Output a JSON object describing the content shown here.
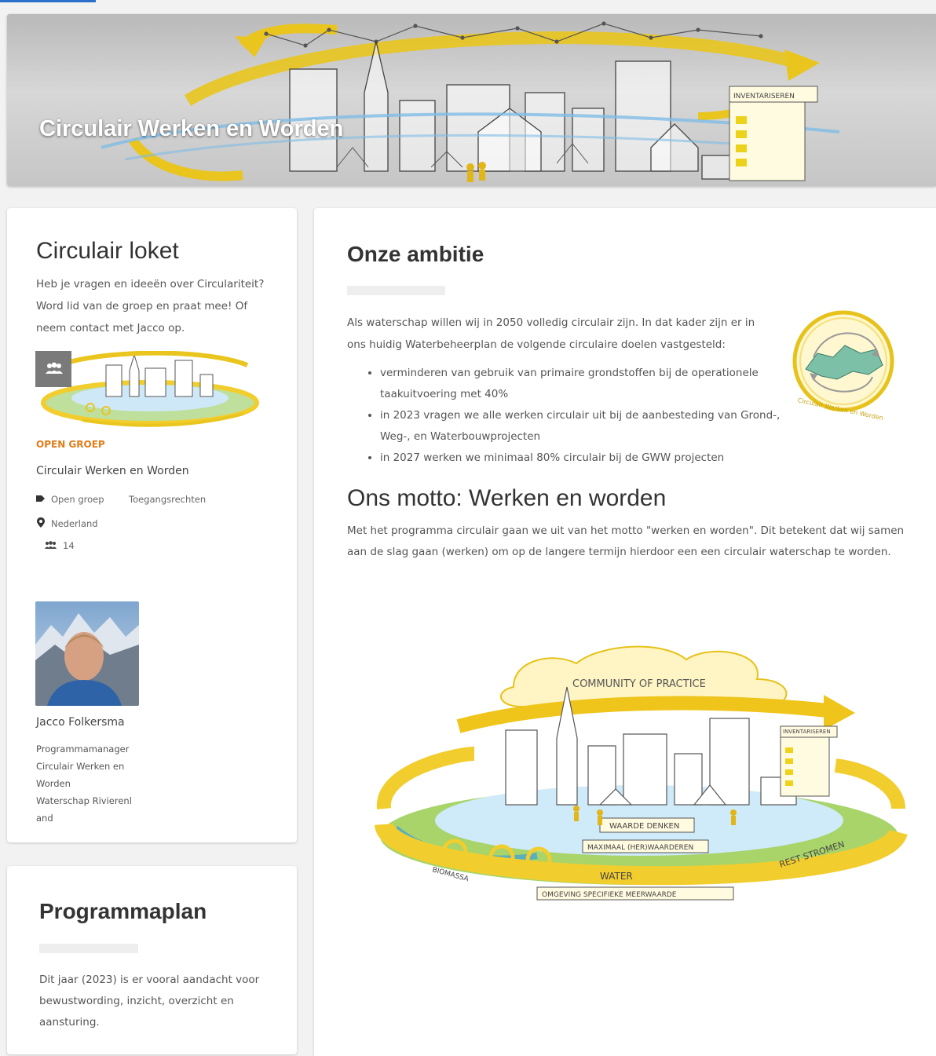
{
  "hero": {
    "title": "Circulair Werken en Worden"
  },
  "loket": {
    "title": "Circulair loket",
    "description": "Heb je vragen en ideeën over Circulariteit? Word lid van de groep en praat mee! Of neem contact met Jacco op.",
    "group": {
      "type": "OPEN GROEP",
      "name": "Circulair Werken en Worden",
      "visibility": "Open groep",
      "access": "Toegangsrechten",
      "location": "Nederland",
      "members": "14"
    },
    "contact": {
      "name": "Jacco Folkersma",
      "role": "Programmamanager Circulair Werken en Worden",
      "organization": "Waterschap Rivierenland"
    }
  },
  "plan": {
    "title": "Programmaplan",
    "text": "Dit jaar (2023) is er vooral aandacht voor bewustwording, inzicht, overzicht en aansturing."
  },
  "ambition": {
    "title": "Onze ambitie",
    "intro": "Als waterschap willen wij in 2050 volledig circulair zijn. In dat kader zijn er in ons huidig Waterbeheerplan de volgende circulaire doelen vastgesteld:",
    "goals": [
      "verminderen van gebruik van primaire grondstoffen bij de operationele taakuitvoering met 40%",
      "in 2023 vragen we alle werken circulair uit bij de aanbesteding van Grond-, Weg-, en Waterbouwprojecten",
      "in 2027 werken we minimaal 80% circulair bij de GWW projecten"
    ],
    "logo_text": "Circulair Werken en Worden"
  },
  "motto": {
    "title": "Ons motto: Werken en worden",
    "text": "Met het programma circulair gaan we uit van het motto \"werken en worden\". Dit betekent dat wij samen aan de slag gaan (werken) om op de langere termijn hierdoor een een circulair waterschap te worden."
  },
  "illustration": {
    "banner": "COMMUNITY OF PRACTICE",
    "labels": [
      "INVENTARISEREN",
      "WAARDE DENKEN",
      "MAXIMAAL (HER)WAARDEREN",
      "WATER",
      "REST STROMEN",
      "BIOMASSA",
      "OMGEVING SPECIFIEKE MEERWAARDE"
    ]
  },
  "colors": {
    "accent": "#e37b18",
    "illustration_yellow": "#f2cd2e",
    "illustration_green": "#7fbf3a",
    "illustration_blue": "#3a9bd6"
  }
}
